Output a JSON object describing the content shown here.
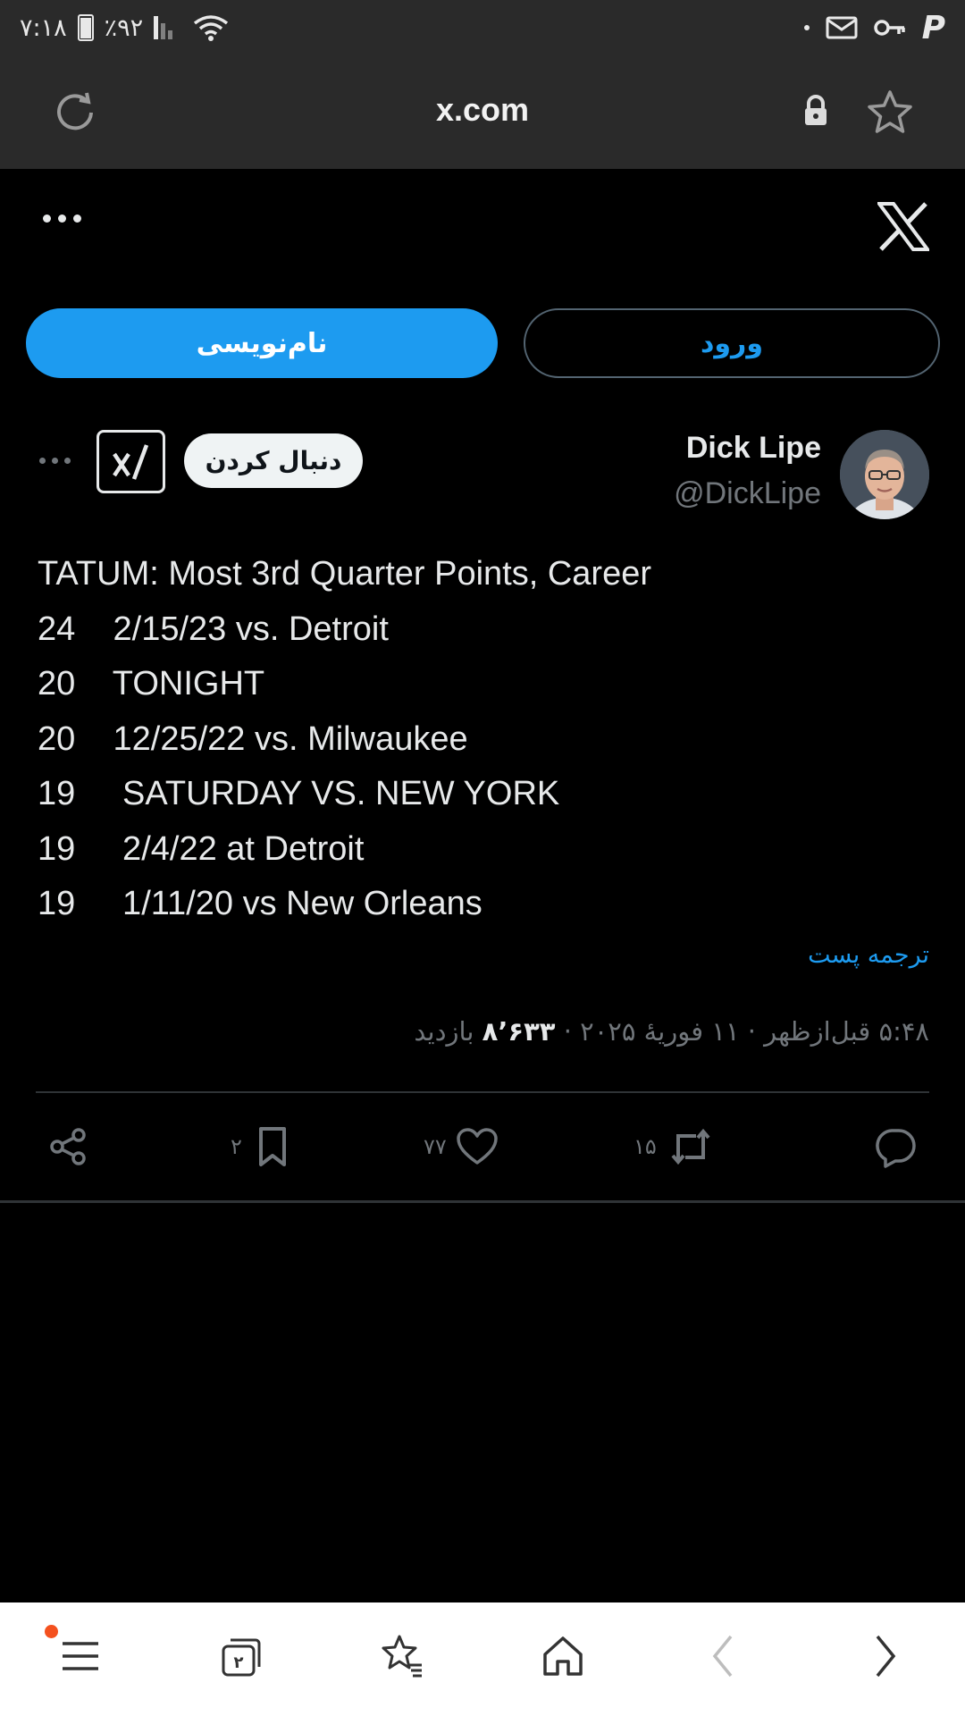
{
  "status_bar": {
    "time": "۷:۱۸",
    "battery": "٪۹۲"
  },
  "browser": {
    "url": "x.com"
  },
  "auth": {
    "signup_label": "نام‌نویسی",
    "login_label": "ورود"
  },
  "tweet": {
    "author_name": "Dick Lipe",
    "author_handle": "@DickLipe",
    "follow_label": "دنبال کردن",
    "body": "TATUM: Most 3rd Quarter Points, Career\n24    2/15/23 vs. Detroit\n20    TONIGHT\n20    12/25/22 vs. Milwaukee\n19     SATURDAY VS. NEW YORK\n19     2/4/22 at Detroit\n19     1/11/20 vs New Orleans",
    "translate_label": "ترجمه پست",
    "timestamp": "۵:۴۸ قبل‌ازظهر · ۱۱ فوریهٔ ۲۰۲۵ · ",
    "views_count": "۸٬۶۳۳",
    "views_label": " بازدید"
  },
  "actions": {
    "retweets": "۱۵",
    "likes": "۷۷",
    "bookmarks": "۲"
  },
  "colors": {
    "accent": "#1d9bf0",
    "background": "#000000",
    "chrome": "#2a2a2a",
    "muted": "#71767b"
  }
}
